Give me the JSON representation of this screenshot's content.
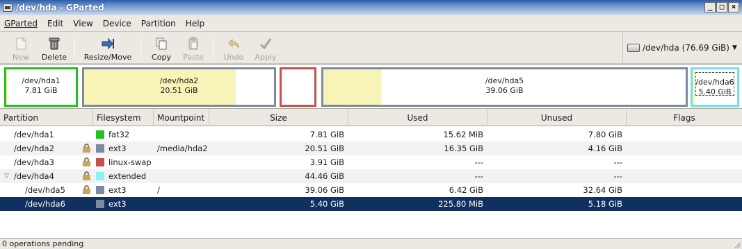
{
  "window": {
    "title": "/dev/hda - GParted"
  },
  "menu": [
    "GParted",
    "Edit",
    "View",
    "Device",
    "Partition",
    "Help"
  ],
  "toolbar": {
    "new": "New",
    "delete": "Delete",
    "resize_move": "Resize/Move",
    "copy": "Copy",
    "paste": "Paste",
    "undo": "Undo",
    "apply": "Apply"
  },
  "device_selector": {
    "value": "/dev/hda  (76.69 GiB)"
  },
  "disk_map": [
    {
      "name": "/dev/hda1",
      "size": "7.81 GiB",
      "border": "#22c11e",
      "used_fraction": 0.002
    },
    {
      "name": "/dev/hda2",
      "size": "20.51 GiB",
      "border": "#7b8a9e",
      "used_fraction": 0.8
    },
    {
      "name": "",
      "size": "",
      "border": "#c4524a",
      "used_fraction": 0
    },
    {
      "name": "/dev/hda5",
      "size": "39.06 GiB",
      "border": "#7b8a9e",
      "used_fraction": 0.16
    },
    {
      "name": "/dev/hda6",
      "size": "5.40 GiB",
      "border": "#6fe0ee",
      "used_fraction": 0.04
    }
  ],
  "table": {
    "headers": [
      "Partition",
      "Filesystem",
      "Mountpoint",
      "Size",
      "Used",
      "Unused",
      "Flags"
    ],
    "rows": [
      {
        "partition": "/dev/hda1",
        "fs": "fat32",
        "fs_color": "#22c11e",
        "mount": "",
        "size": "7.81 GiB",
        "used": "15.62 MiB",
        "unused": "7.80 GiB",
        "locked": false
      },
      {
        "partition": "/dev/hda2",
        "fs": "ext3",
        "fs_color": "#7b8a9e",
        "mount": "/media/hda2",
        "size": "20.51 GiB",
        "used": "16.35 GiB",
        "unused": "4.16 GiB",
        "locked": true
      },
      {
        "partition": "/dev/hda3",
        "fs": "linux-swap",
        "fs_color": "#c4524a",
        "mount": "",
        "size": "3.91 GiB",
        "used": "---",
        "unused": "---",
        "locked": true
      },
      {
        "partition": "/dev/hda4",
        "fs": "extended",
        "fs_color": "#8ef0f8",
        "mount": "",
        "size": "44.46 GiB",
        "used": "---",
        "unused": "---",
        "locked": true
      },
      {
        "partition": "/dev/hda5",
        "fs": "ext3",
        "fs_color": "#7b8a9e",
        "mount": "/",
        "size": "39.06 GiB",
        "used": "6.42 GiB",
        "unused": "32.64 GiB",
        "locked": true
      },
      {
        "partition": "/dev/hda6",
        "fs": "ext3",
        "fs_color": "#7b8a9e",
        "mount": "",
        "size": "5.40 GiB",
        "used": "225.80 MiB",
        "unused": "5.18 GiB",
        "locked": false
      }
    ]
  },
  "status": {
    "text": "0 operations pending"
  },
  "colors": {
    "selection": "#10305f",
    "used_fill": "#f8f4b8"
  }
}
